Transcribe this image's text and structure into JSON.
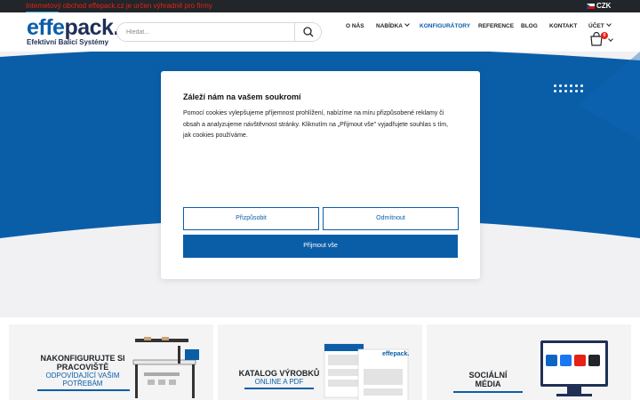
{
  "topbar": {
    "promo": "Internetový obchod effepack.cz je určen výhradně pro firmy",
    "currency": "CZK"
  },
  "header": {
    "logo_word_1": "effe",
    "logo_word_2": "pack",
    "logo_dot": ".",
    "tagline": "Efektivní Balicí Systémy",
    "search_placeholder": "Hledat...",
    "nav": [
      {
        "label": "O NÁS"
      },
      {
        "label": "NABÍDKA"
      },
      {
        "label": "KONFIGURÁTORY"
      },
      {
        "label": "REFERENCE"
      },
      {
        "label": "BLOG"
      },
      {
        "label": "KONTAKT"
      },
      {
        "label": "ÚČET"
      }
    ],
    "cart_count": "0"
  },
  "cookie": {
    "title": "Záleží nám na vašem soukromí",
    "body": "Pomocí cookies vylepšujeme příjemnost prohlížení, nabízíme na míru přizpůsobené reklamy či obsah a analyzujeme návštěvnost stránky. Kliknutím na „Přijmout vše\" vyjadřujete souhlas s tím, jak cookies používáme.",
    "customize": "Přizpůsobit",
    "reject": "Odmítnout",
    "accept": "Přijmout vše"
  },
  "banners": [
    {
      "title_1": "NAKONFIGURUJTE SI",
      "title_2": "PRACOVIŠTĚ",
      "sub_1": "ODPOVÍDAJÍCÍ VAŠIM",
      "sub_2": "POTŘEBÁM"
    },
    {
      "title_1": "KATALOG VÝROBKŮ",
      "sub_1": "ONLINE A PDF",
      "catalog_logo": "effepack."
    },
    {
      "title_1": "SOCIÁLNÍ",
      "title_2": "MÉDIA"
    }
  ],
  "colors": {
    "brand_blue": "#0a5ea8",
    "navy": "#1f2f56",
    "topbar": "#222529",
    "promo_red": "#e62117"
  },
  "icons": {
    "search": "magnifier-icon",
    "cart": "shopping-bag-icon",
    "flag": "czech-flag-icon",
    "social": [
      "linkedin-icon",
      "facebook-icon",
      "youtube-icon",
      "instagram-icon"
    ]
  }
}
